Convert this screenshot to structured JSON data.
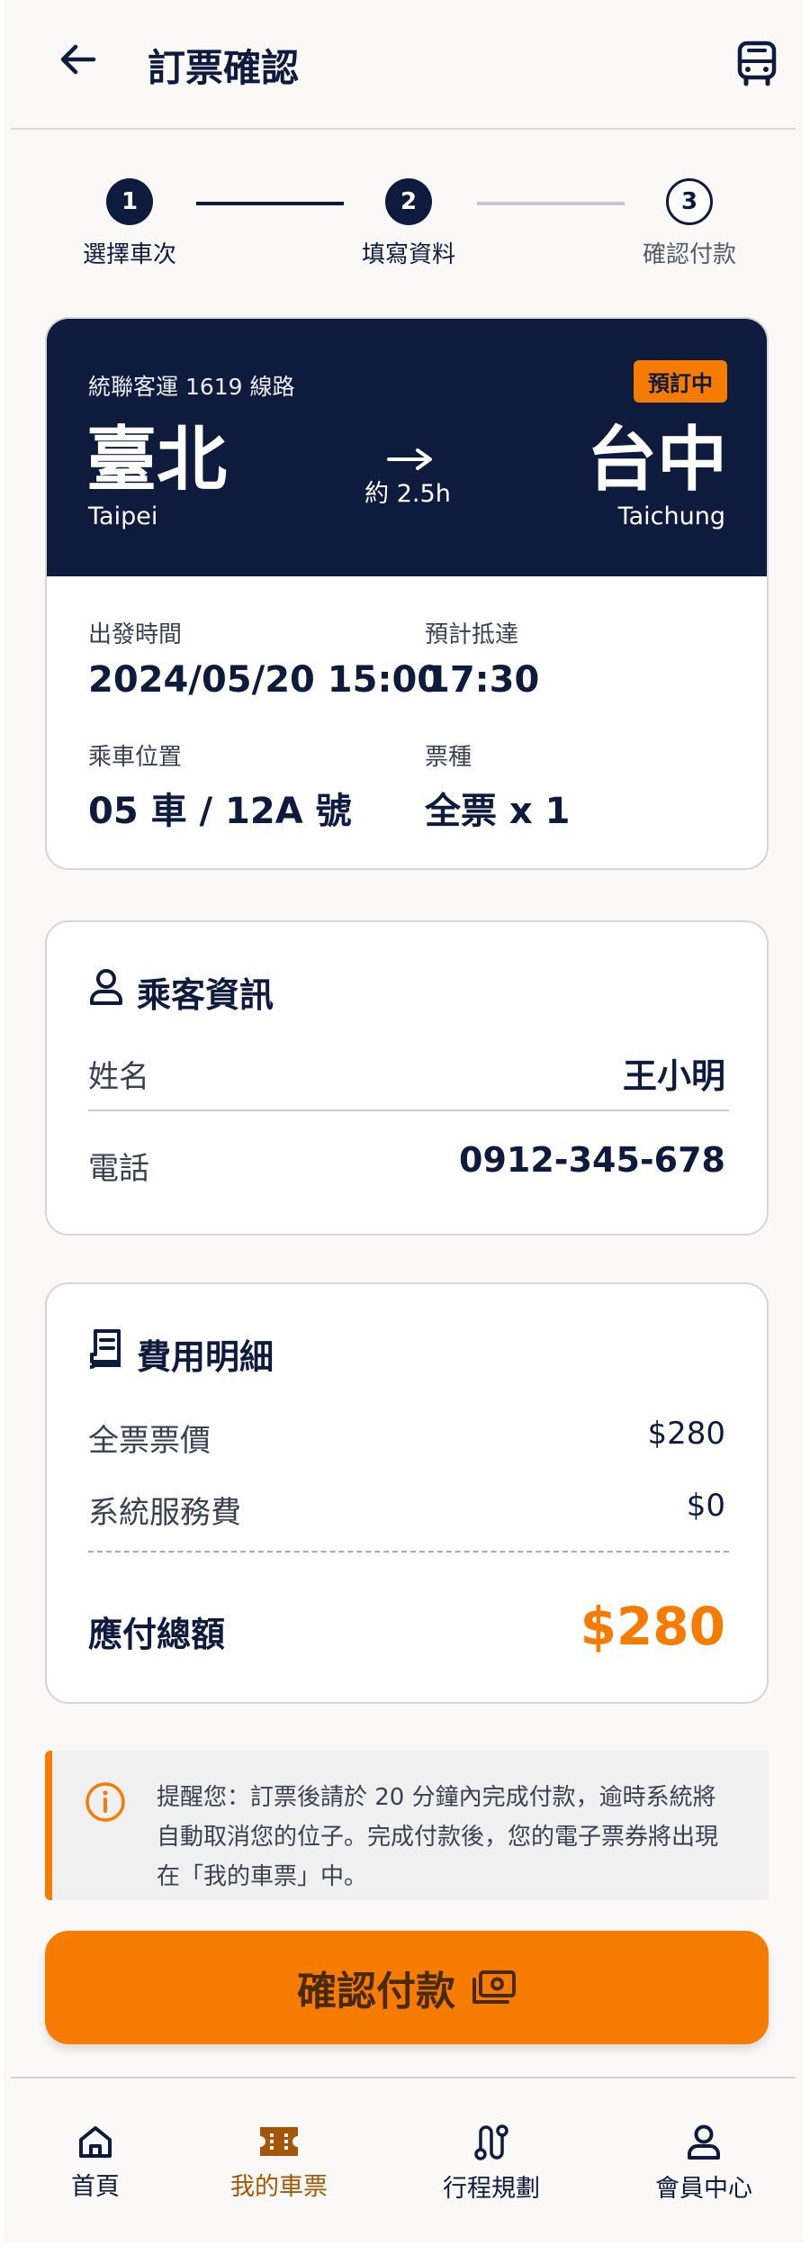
{
  "header": {
    "title": "訂票確認"
  },
  "stepper": {
    "steps": [
      {
        "number": "1",
        "label": "選擇車次"
      },
      {
        "number": "2",
        "label": "填寫資料"
      },
      {
        "number": "3",
        "label": "確認付款"
      }
    ]
  },
  "trip": {
    "route": "統聯客運 1619 線路",
    "status": "預訂中",
    "from": "臺北",
    "from_en": "Taipei",
    "to": "台中",
    "to_en": "Taichung",
    "duration": "約 2.5h",
    "departure_label": "出發時間",
    "departure_value": "2024/05/20 15:00",
    "arrival_label": "預計抵達",
    "arrival_value": "17:30",
    "seat_label": "乘車位置",
    "seat_value": "05 車 / 12A 號",
    "ticket_label": "票種",
    "ticket_value": "全票 x 1"
  },
  "passenger": {
    "title": "乘客資訊",
    "name_label": "姓名",
    "name_value": "王小明",
    "phone_label": "電話",
    "phone_value": "0912-345-678"
  },
  "fees": {
    "title": "費用明細",
    "items": [
      {
        "label": "全票票價",
        "value": "$280"
      },
      {
        "label": "系統服務費",
        "value": "$0"
      }
    ],
    "total_label": "應付總額",
    "total_value": "$280"
  },
  "notice": {
    "text": "提醒您：訂票後請於 20 分鐘內完成付款，逾時系統將自動取消您的位子。完成付款後，您的電子票券將出現在「我的車票」中。"
  },
  "confirm_button": {
    "label": "確認付款"
  },
  "nav": {
    "items": [
      {
        "label": "首頁",
        "icon": "home-icon"
      },
      {
        "label": "我的車票",
        "icon": "ticket-icon"
      },
      {
        "label": "行程規劃",
        "icon": "route-icon"
      },
      {
        "label": "會員中心",
        "icon": "user-icon"
      }
    ],
    "active": "我的車票"
  },
  "colors": {
    "navy": "#0f1b3d",
    "accent": "#f57c00",
    "background": "#faf9f7"
  }
}
